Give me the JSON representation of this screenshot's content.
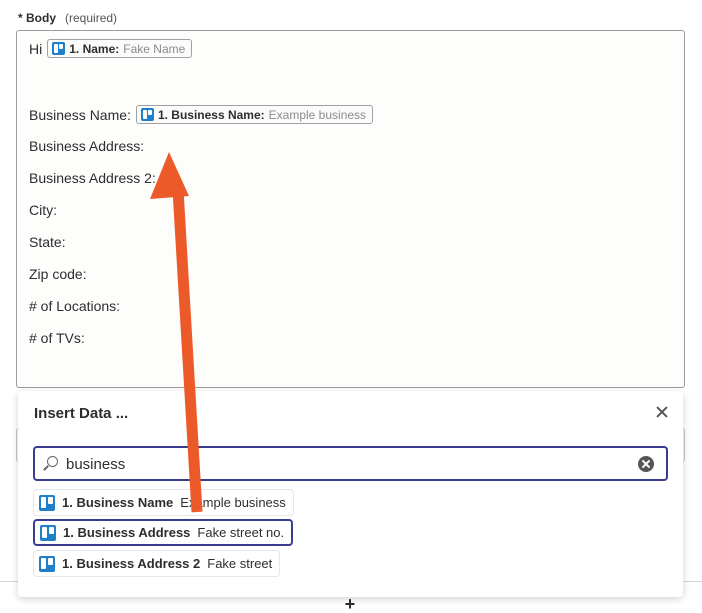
{
  "field": {
    "marker": "*",
    "label": "Body",
    "required_note": "(required)"
  },
  "editor": {
    "greeting": "Hi",
    "name_pill": {
      "key": "1. Name:",
      "value": "Fake Name"
    },
    "business_name_label": "Business Name:",
    "business_name_pill": {
      "key": "1. Business Name:",
      "value": "Example business"
    },
    "lines": [
      "Business Address:",
      "Business Address 2:",
      "City:",
      "State:",
      "Zip code:",
      "# of Locations:",
      "# of TVs:"
    ]
  },
  "insert_panel": {
    "title": "Insert Data ...",
    "search_value": "business",
    "results": [
      {
        "key": "1. Business Name",
        "value": "Example business",
        "selected": false
      },
      {
        "key": "1. Business Address",
        "value": "Fake street no.",
        "selected": true
      },
      {
        "key": "1. Business Address 2",
        "value": "Fake street",
        "selected": false
      }
    ]
  },
  "colors": {
    "accent": "#3a3d8f",
    "trello_blue": "#1f7fc9",
    "annotation_arrow": "#ec5a2a"
  },
  "icons": [
    "trello-icon",
    "search-icon",
    "clear-icon",
    "close-icon",
    "plus-icon"
  ]
}
